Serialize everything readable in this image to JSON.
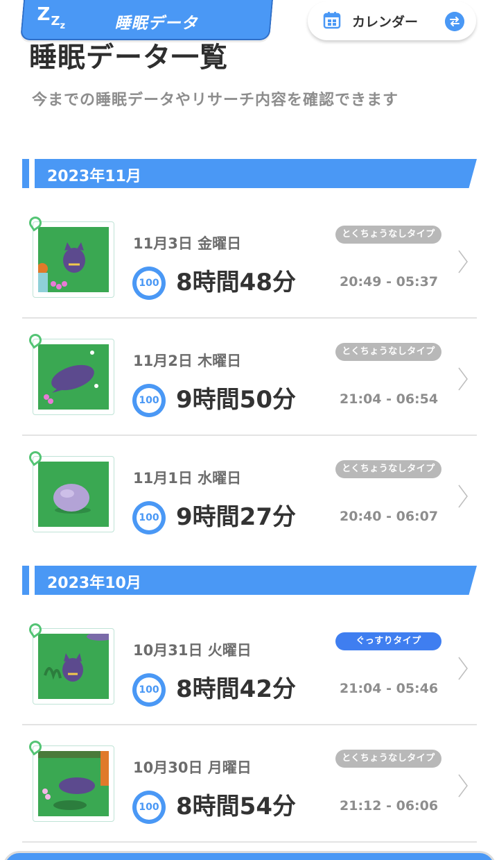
{
  "header": {
    "tab_title": "睡眠データ",
    "zzz_1": "Z",
    "zzz_2": "Z",
    "zzz_3": "z",
    "calendar_label": "カレンダー"
  },
  "page": {
    "title": "睡眠データ一覧",
    "subtitle": "今までの睡眠データやリサーチ内容を確認できます"
  },
  "months": [
    {
      "label": "2023年11月"
    },
    {
      "label": "2023年10月"
    }
  ],
  "entries": [
    {
      "date": "11月3日 金曜日",
      "type": "とくちょうなしタイプ",
      "score": "100",
      "duration": "8時間48分",
      "time_range": "20:49 - 05:37"
    },
    {
      "date": "11月2日 木曜日",
      "type": "とくちょうなしタイプ",
      "score": "100",
      "duration": "9時間50分",
      "time_range": "21:04 - 06:54"
    },
    {
      "date": "11月1日 水曜日",
      "type": "とくちょうなしタイプ",
      "score": "100",
      "duration": "9時間27分",
      "time_range": "20:40 - 06:07"
    },
    {
      "date": "10月31日 火曜日",
      "type": "ぐっすりタイプ",
      "score": "100",
      "duration": "8時間42分",
      "time_range": "21:04 - 05:46"
    },
    {
      "date": "10月30日 月曜日",
      "type": "とくちょうなしタイプ",
      "score": "100",
      "duration": "8時間54分",
      "time_range": "21:12 - 06:06"
    }
  ],
  "colors": {
    "accent": "#4a98f5",
    "badge_neutral": "#b8b8b8",
    "badge_deep": "#3f7ef0",
    "grass": "#3aa852"
  },
  "icons": {
    "calendar": "calendar-icon",
    "swap": "swap-icon",
    "chevron": "chevron-right-icon",
    "clip": "paperclip-icon"
  }
}
